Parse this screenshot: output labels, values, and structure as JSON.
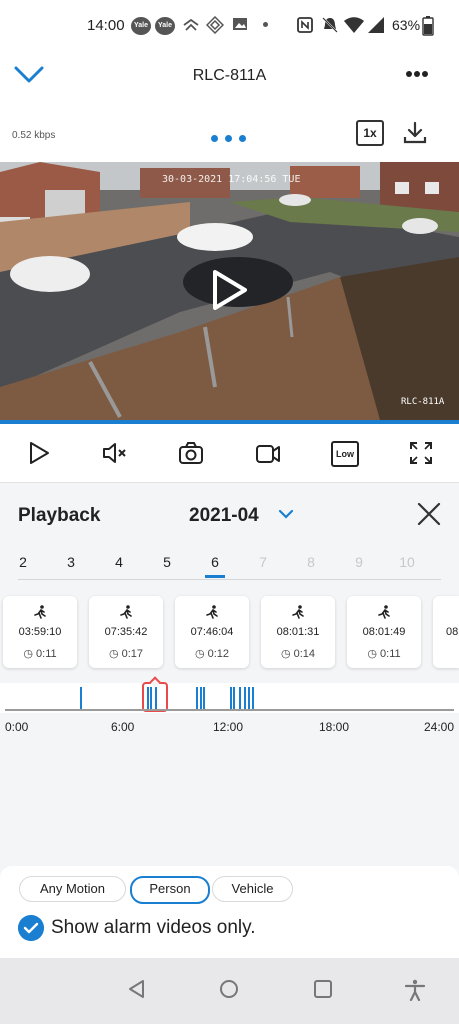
{
  "status_bar": {
    "time": "14:00",
    "app_badge_1": "Yale",
    "app_badge_2": "Yale",
    "battery": "63%"
  },
  "header": {
    "title": "RLC-811A",
    "bitrate": "0.52 kbps",
    "speed": "1x"
  },
  "video": {
    "osd_timestamp": "30-03-2021 17:04:56 TUE",
    "osd_camera": "RLC-811A",
    "progress": 1.0
  },
  "controls": {
    "quality_label": "Low"
  },
  "playback": {
    "title": "Playback",
    "month": "2021-04",
    "days": [
      {
        "label": "2",
        "state": "enabled"
      },
      {
        "label": "3",
        "state": "enabled"
      },
      {
        "label": "4",
        "state": "enabled"
      },
      {
        "label": "5",
        "state": "enabled"
      },
      {
        "label": "6",
        "state": "selected"
      },
      {
        "label": "7",
        "state": "disabled"
      },
      {
        "label": "8",
        "state": "disabled"
      },
      {
        "label": "9",
        "state": "disabled"
      },
      {
        "label": "10",
        "state": "disabled"
      }
    ],
    "events": [
      {
        "time": "03:59:10",
        "duration": "0:11"
      },
      {
        "time": "07:35:42",
        "duration": "0:17"
      },
      {
        "time": "07:46:04",
        "duration": "0:12"
      },
      {
        "time": "08:01:31",
        "duration": "0:14"
      },
      {
        "time": "08:01:49",
        "duration": "0:11"
      },
      {
        "time": "08",
        "duration": ""
      }
    ],
    "timeline_labels": [
      "0:00",
      "6:00",
      "12:00",
      "18:00",
      "24:00"
    ],
    "timeline_events_hours": [
      3.99,
      7.6,
      7.77,
      8.02,
      8.03,
      10.2,
      10.4,
      10.6,
      12.0,
      12.2,
      12.5,
      12.8,
      13.0,
      13.2
    ]
  },
  "filters": {
    "chips": [
      {
        "label": "Any Motion",
        "selected": false
      },
      {
        "label": "Person",
        "selected": true
      },
      {
        "label": "Vehicle",
        "selected": false
      }
    ],
    "show_alarm_label": "Show alarm videos only.",
    "show_alarm_checked": true
  },
  "colors": {
    "accent": "#1a7fd1",
    "marker": "#e94b4b"
  }
}
